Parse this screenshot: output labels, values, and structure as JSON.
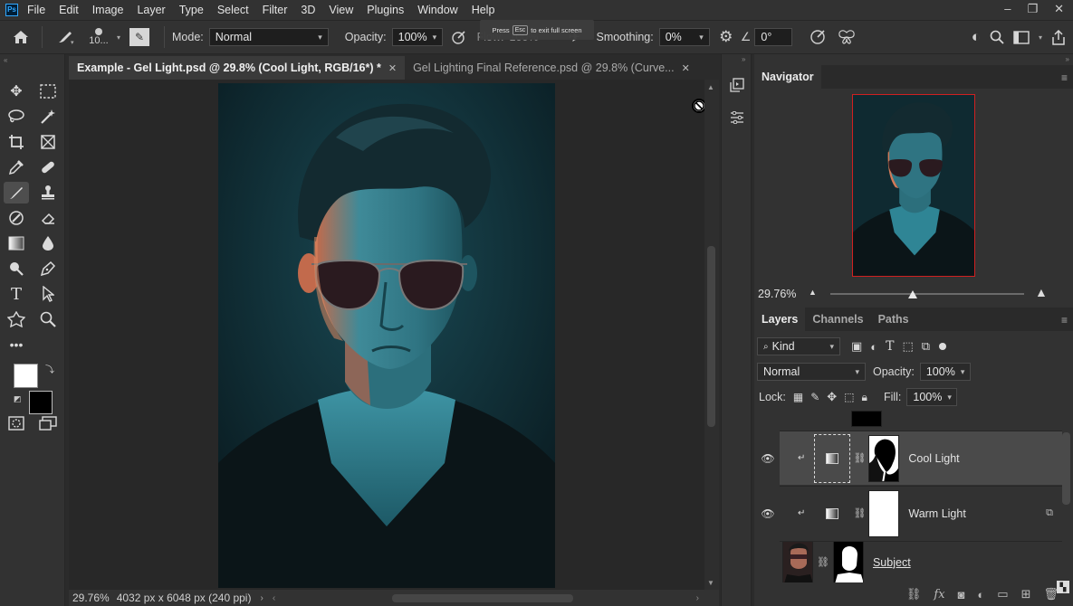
{
  "menubar": {
    "logo": "Ps",
    "items": [
      "File",
      "Edit",
      "Image",
      "Layer",
      "Type",
      "Select",
      "Filter",
      "3D",
      "View",
      "Plugins",
      "Window",
      "Help"
    ]
  },
  "options": {
    "brush_size": "10...",
    "mode_label": "Mode:",
    "mode_value": "Normal",
    "opacity_label": "Opacity:",
    "opacity_value": "100%",
    "flow_label": "Flow:",
    "flow_value": "100%",
    "smoothing_label": "Smoothing:",
    "smoothing_value": "0%",
    "angle_value": "0°"
  },
  "esc_tip": {
    "press": "Press",
    "key": "Esc",
    "message": "to exit full screen"
  },
  "doc_tabs": [
    {
      "title": "Example - Gel Light.psd @ 29.8% (Cool Light, RGB/16*) *",
      "active": true
    },
    {
      "title": "Gel Lighting Final Reference.psd @ 29.8% (Curve...",
      "active": false
    }
  ],
  "status": {
    "zoom": "29.76%",
    "doc_info": "4032 px x 6048 px (240 ppi)"
  },
  "navigator": {
    "title": "Navigator",
    "zoom": "29.76%"
  },
  "layers_panel": {
    "tabs": [
      "Layers",
      "Channels",
      "Paths"
    ],
    "filter_kind": "Kind",
    "blend_mode": "Normal",
    "opacity_label": "Opacity:",
    "opacity_value": "100%",
    "lock_label": "Lock:",
    "fill_label": "Fill:",
    "fill_value": "100%",
    "layers": [
      {
        "name": "Cool Light",
        "selected": true
      },
      {
        "name": "Warm Light",
        "selected": false
      },
      {
        "name": "Subject",
        "selected": false
      }
    ]
  },
  "colors": {
    "accent": "#31a8ff",
    "cool_light": "#1f7d8c",
    "warm_light": "#e0805a"
  }
}
